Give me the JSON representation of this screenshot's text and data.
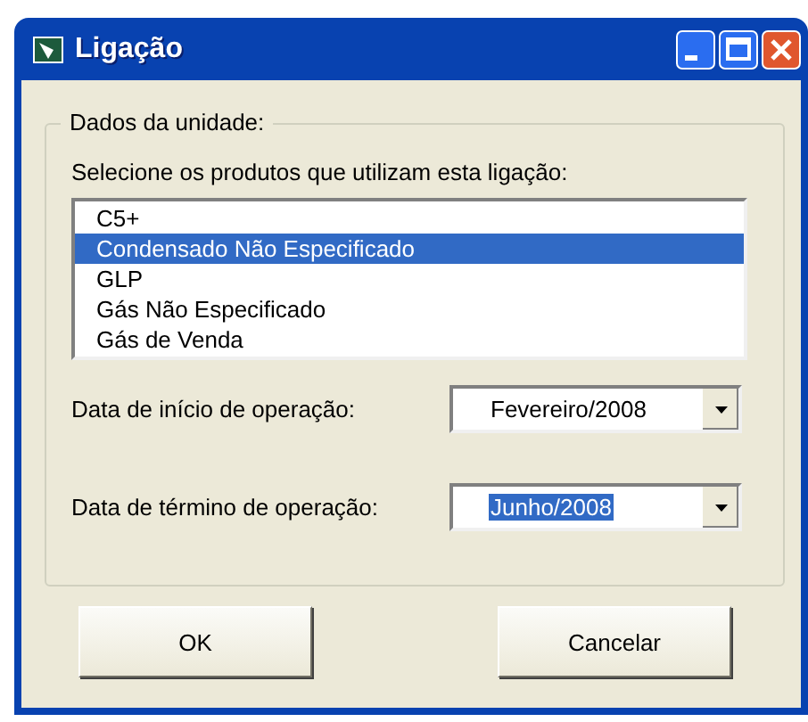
{
  "window": {
    "title": "Ligação"
  },
  "group": {
    "legend": "Dados da unidade:",
    "prompt": "Selecione os produtos que utilizam esta ligação:",
    "products": [
      {
        "label": "C5+",
        "selected": false
      },
      {
        "label": "Condensado Não Especificado",
        "selected": true
      },
      {
        "label": "GLP",
        "selected": false
      },
      {
        "label": "Gás Não Especificado",
        "selected": false
      },
      {
        "label": "Gás de Venda",
        "selected": false
      }
    ],
    "dates": [
      {
        "label": "Data de início de operação:",
        "value": "Fevereiro/2008",
        "text_selected": false
      },
      {
        "label": "Data de término de operação:",
        "value": "Junho/2008",
        "text_selected": true
      }
    ]
  },
  "buttons": [
    "OK",
    "Cancelar"
  ]
}
